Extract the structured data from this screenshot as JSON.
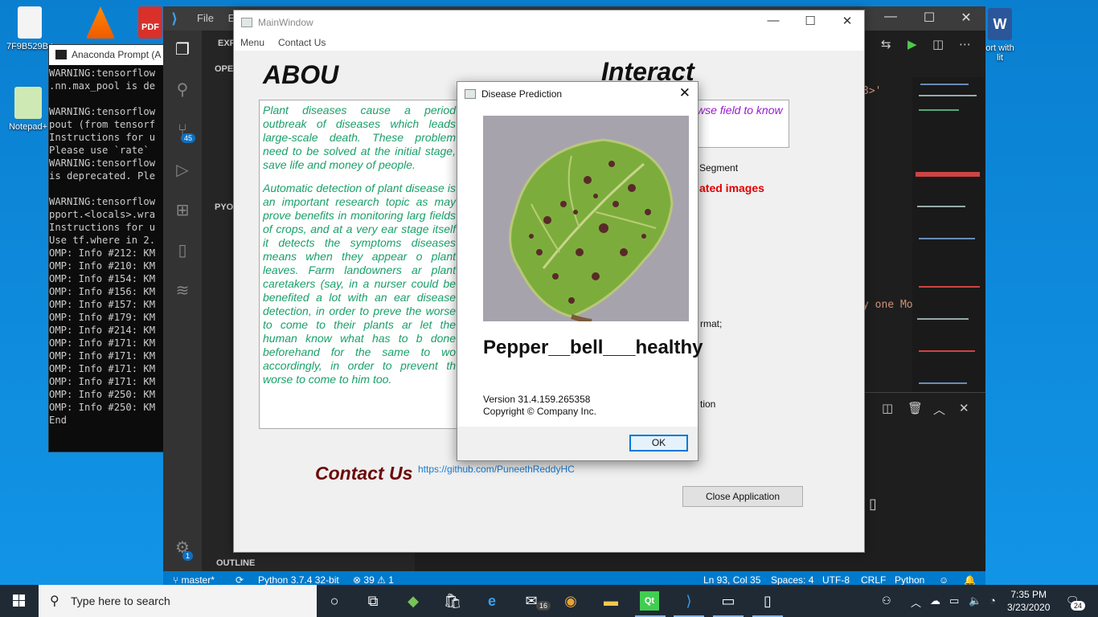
{
  "desktop": {
    "icons": [
      {
        "label": "7F9B529B.t",
        "color": "#f4f4f4"
      },
      {
        "label": "Notepad+",
        "color": "#cfe9b4"
      },
      {
        "label": "ort with\nlit",
        "color": "#2b579a"
      }
    ]
  },
  "anaconda": {
    "title": "Anaconda Prompt (A",
    "lines": "WARNING:tensorflow\n.nn.max_pool is de\n\nWARNING:tensorflow\npout (from tensorf\nInstructions for u\nPlease use `rate`\nWARNING:tensorflow\nis deprecated. Ple\n\nWARNING:tensorflow\npport.<locals>.wra\nInstructions for u\nUse tf.where in 2.\nOMP: Info #212: KM\nOMP: Info #210: KM\nOMP: Info #154: KM\nOMP: Info #156: KM\nOMP: Info #157: KM\nOMP: Info #179: KM\nOMP: Info #214: KM\nOMP: Info #171: KM\nOMP: Info #171: KM\nOMP: Info #171: KM\nOMP: Info #171: KM\nOMP: Info #250: KM\nOMP: Info #250: KM\nEnd"
  },
  "vscode": {
    "menu": [
      "File",
      "Ed"
    ],
    "sidebar": {
      "open_label": "OPE",
      "python_label": "PYO",
      "outline_label": "OUTLINE",
      "explorer_label": "EXP"
    },
    "source_badge": "45",
    "gear_badge": "1",
    "code_fragments": [
      "3>'",
      "y one Mo"
    ],
    "status": {
      "branch": "master*",
      "python": "Python 3.7.4 32-bit",
      "problems": "39",
      "warnings": "1",
      "position": "Ln 93, Col 35",
      "spaces": "Spaces: 4",
      "encoding": "UTF-8",
      "eol": "CRLF",
      "language": "Python"
    }
  },
  "mainwindow": {
    "title": "MainWindow",
    "menu": [
      "Menu",
      "Contact Us"
    ],
    "about_heading": "ABOU",
    "interact_heading": "Interact",
    "about_p1": "Plant diseases cause a period outbreak of diseases which leads large-scale death. These problem need to be solved at the initial stage, save life and money of people.",
    "about_p2": "Automatic detection of plant disease is an important research topic as may prove benefits in monitoring larg fields of crops, and at a very ear stage itself it detects the symptoms diseases means when they appear o plant leaves. Farm landowners ar plant caretakers (say, in a nurser could be benefited a lot with an ear disease detection, in order to preve the worse to come to their plants ar let the human know what has to b done beforehand for the same to wo accordingly, in order to prevent th worse to come to him too.",
    "interact_text": "wse field to know",
    "segment_label": "Segment",
    "red_label": "ated images",
    "format_label": "rmat;",
    "tion_label": "tion",
    "contact_heading": "Contact Us",
    "github_link": "https://github.com/PuneethReddyHC",
    "close_button": "Close Application"
  },
  "dialog": {
    "title": "Disease Prediction",
    "prediction": "Pepper__bell___healthy",
    "version": "Version 31.4.159.265358",
    "copyright": "Copyright © Company Inc.",
    "ok": "OK"
  },
  "taskbar": {
    "search_placeholder": "Type here to search",
    "mail_badge": "16",
    "time": "7:35 PM",
    "date": "3/23/2020",
    "notif_count": "24"
  },
  "colors": {
    "about_text": "#1aa06a",
    "interact_text": "#9a1ad1",
    "red_label": "#e00000",
    "contact_heading": "#6b0a0a",
    "vscode_status": "#007acc"
  }
}
